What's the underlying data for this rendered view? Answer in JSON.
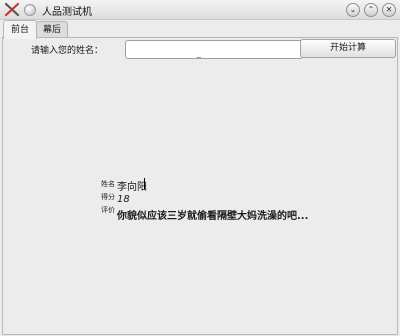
{
  "window": {
    "title": "人品测试机"
  },
  "tabs": [
    {
      "label": "前台",
      "active": true
    },
    {
      "label": "幕后",
      "active": false
    }
  ],
  "form": {
    "name_label": "请输入您的姓名：",
    "name_input_value": "",
    "start_button": "开始计算"
  },
  "result": {
    "name_label": "姓名",
    "name_value": "李向阳",
    "score_label": "得分",
    "score_value": "18",
    "comment_label": "评价",
    "comment_value": "你貌似应该三岁就偷看隔壁大妈洗澡的吧..."
  },
  "icons": {
    "app": "tools-icon",
    "shade": "shade-icon",
    "minimize": "minimize-icon",
    "maximize": "maximize-icon",
    "close": "close-icon"
  },
  "colors": {
    "background": "#ececec",
    "input_bg": "#ffffff",
    "text": "#1a1a1a"
  }
}
